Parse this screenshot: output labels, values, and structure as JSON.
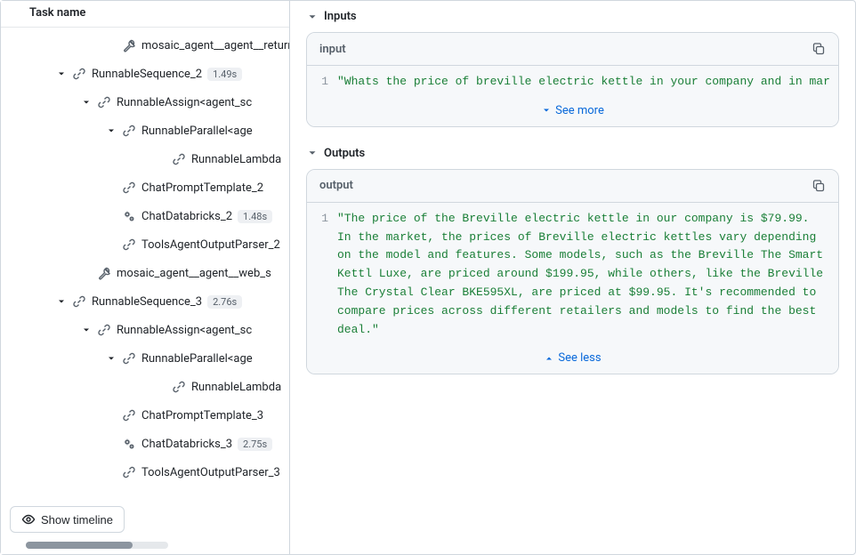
{
  "leftPane": {
    "header": "Task name",
    "showTimeline": "Show timeline",
    "rows": [
      {
        "indent": 3,
        "chev": null,
        "iconType": "wrench",
        "label": "mosaic_agent__agent__return_",
        "badge": null
      },
      {
        "indent": 1,
        "chev": "down",
        "iconType": "chain",
        "label": "RunnableSequence_2",
        "badge": "1.49s"
      },
      {
        "indent": 2,
        "chev": "down",
        "iconType": "chain",
        "label": "RunnableAssign<agent_sc",
        "badge": null
      },
      {
        "indent": 3,
        "chev": "down",
        "iconType": "chain",
        "label": "RunnableParallel<age",
        "badge": null
      },
      {
        "indent": 5,
        "chev": null,
        "iconType": "chain",
        "label": "RunnableLambda",
        "badge": null
      },
      {
        "indent": 3,
        "chev": null,
        "iconType": "chain",
        "label": "ChatPromptTemplate_2",
        "badge": ""
      },
      {
        "indent": 3,
        "chev": null,
        "iconType": "gears",
        "label": "ChatDatabricks_2",
        "badge": "1.48s"
      },
      {
        "indent": 3,
        "chev": null,
        "iconType": "chain",
        "label": "ToolsAgentOutputParser_2",
        "badge": null
      },
      {
        "indent": 2,
        "chev": null,
        "iconType": "wrench",
        "label": "mosaic_agent__agent__web_s",
        "badge": null
      },
      {
        "indent": 1,
        "chev": "down",
        "iconType": "chain",
        "label": "RunnableSequence_3",
        "badge": "2.76s"
      },
      {
        "indent": 2,
        "chev": "down",
        "iconType": "chain",
        "label": "RunnableAssign<agent_sc",
        "badge": null
      },
      {
        "indent": 3,
        "chev": "down",
        "iconType": "chain",
        "label": "RunnableParallel<age",
        "badge": null
      },
      {
        "indent": 5,
        "chev": null,
        "iconType": "chain",
        "label": "RunnableLambda",
        "badge": null
      },
      {
        "indent": 3,
        "chev": null,
        "iconType": "chain",
        "label": "ChatPromptTemplate_3",
        "badge": ""
      },
      {
        "indent": 3,
        "chev": null,
        "iconType": "gears",
        "label": "ChatDatabricks_3",
        "badge": "2.75s"
      },
      {
        "indent": 3,
        "chev": null,
        "iconType": "chain",
        "label": "ToolsAgentOutputParser_3",
        "badge": null
      }
    ]
  },
  "rightPane": {
    "inputs": {
      "sectionLabel": "Inputs",
      "cardTitle": "input",
      "lineNo": "1",
      "code": "\"Whats the price of breville electric kettle  in your company and in mar",
      "seeMore": "See more"
    },
    "outputs": {
      "sectionLabel": "Outputs",
      "cardTitle": "output",
      "lineNo": "1",
      "code": "\"The price of the Breville electric kettle in our company is $79.99. In the market, the prices of Breville electric kettles vary depending on the model and features. Some models, such as the Breville The Smart Kettl Luxe, are priced around $199.95, while others, like the Breville The Crystal Clear BKE595XL, are priced at $99.95. It's recommended to compare prices across different retailers and models to find the best deal.\"",
      "seeLess": "See less"
    }
  }
}
